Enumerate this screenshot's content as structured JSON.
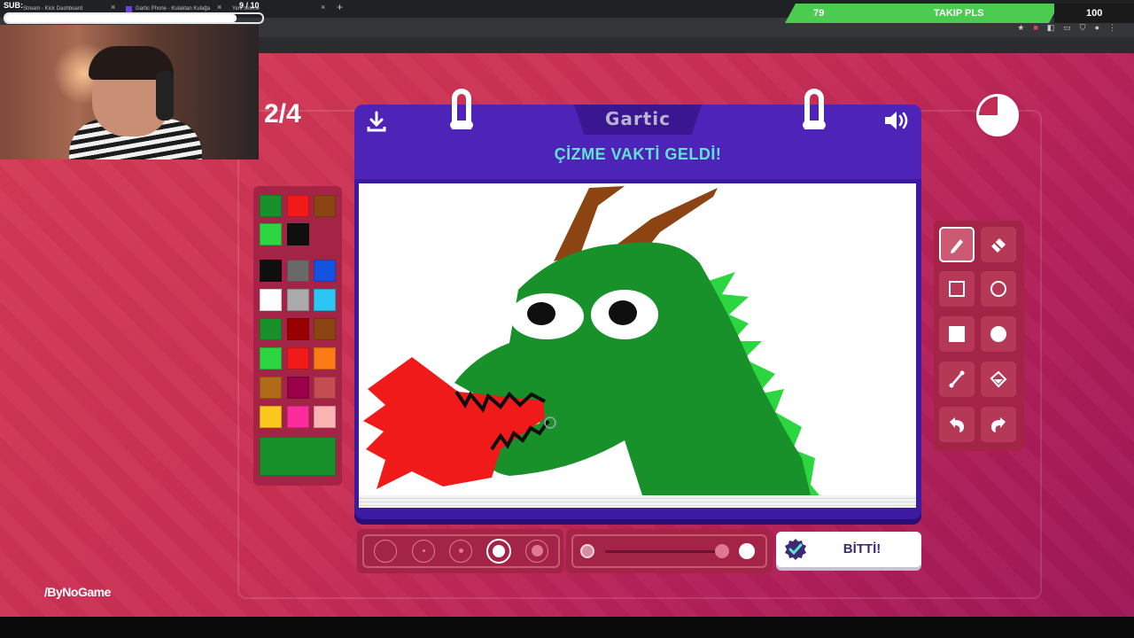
{
  "browser": {
    "tabs": [
      {
        "title": "Stream - Kick Dashboard"
      },
      {
        "title": "Gartic Phone - Kulaktan Kulağa"
      },
      {
        "title": "Yeni sekme"
      }
    ]
  },
  "overlay": {
    "sub_label": "SUB:",
    "sub_count": "9 / 10",
    "follow_current": "79",
    "follow_text": "TAKIP PLS",
    "follow_target": "100",
    "progress_fraction": 0.9
  },
  "game": {
    "round": "2/4",
    "logo": "Gartic",
    "heading": "ÇİZME VAKTİ GELDİ!",
    "done_label": "BİTTİ!",
    "timer_remaining_fraction": 0.75,
    "watermark": "ByNoGame",
    "colors": {
      "row1": [
        "#18912b",
        "#f01a1a",
        "#8c4412"
      ],
      "row2": [
        "#2bd640",
        "#0f0f0f"
      ],
      "grid": [
        [
          "#0f0f0f",
          "#696969",
          "#1453e0"
        ],
        [
          "#ffffff",
          "#aaaaaa",
          "#2cc6f5"
        ],
        [
          "#18912b",
          "#990000",
          "#8c4412"
        ],
        [
          "#2bd640",
          "#f01a1a",
          "#fb7b16"
        ],
        [
          "#b06b18",
          "#990049",
          "#c54c50"
        ],
        [
          "#fbc81d",
          "#fd2c9c",
          "#fbb3b4"
        ]
      ],
      "selected": "#18912b"
    },
    "tools": [
      "pencil-icon",
      "eraser-icon",
      "rectangle-icon",
      "ellipse-icon",
      "filled-rectangle-icon",
      "filled-ellipse-icon",
      "line-icon",
      "fill-bucket-icon",
      "undo-icon",
      "redo-icon"
    ],
    "brush_sizes": [
      1,
      2,
      3,
      4,
      5
    ],
    "selected_size": 4,
    "opacity_fraction": 1.0
  }
}
